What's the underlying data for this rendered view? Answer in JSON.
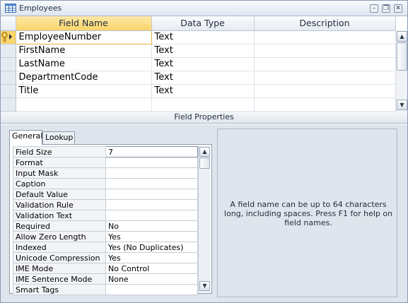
{
  "window": {
    "title": "Employees",
    "minimize": "–",
    "restore": "❐",
    "close": "✕"
  },
  "grid": {
    "columns": [
      "Field Name",
      "Data Type",
      "Description"
    ],
    "rows": [
      {
        "name": "EmployeeNumber",
        "type": "Text",
        "description": "",
        "primary_key": true
      },
      {
        "name": "FirstName",
        "type": "Text",
        "description": ""
      },
      {
        "name": "LastName",
        "type": "Text",
        "description": ""
      },
      {
        "name": "DepartmentCode",
        "type": "Text",
        "description": ""
      },
      {
        "name": "Title",
        "type": "Text",
        "description": ""
      },
      {
        "name": "",
        "type": "",
        "description": ""
      }
    ]
  },
  "field_properties": {
    "header": "Field Properties",
    "tabs": [
      "General",
      "Lookup"
    ],
    "properties": [
      {
        "name": "Field Size",
        "value": "7"
      },
      {
        "name": "Format",
        "value": ""
      },
      {
        "name": "Input Mask",
        "value": ""
      },
      {
        "name": "Caption",
        "value": ""
      },
      {
        "name": "Default Value",
        "value": ""
      },
      {
        "name": "Validation Rule",
        "value": ""
      },
      {
        "name": "Validation Text",
        "value": ""
      },
      {
        "name": "Required",
        "value": "No"
      },
      {
        "name": "Allow Zero Length",
        "value": "Yes"
      },
      {
        "name": "Indexed",
        "value": "Yes (No Duplicates)"
      },
      {
        "name": "Unicode Compression",
        "value": "Yes"
      },
      {
        "name": "IME Mode",
        "value": "No Control"
      },
      {
        "name": "IME Sentence Mode",
        "value": "None"
      },
      {
        "name": "Smart Tags",
        "value": ""
      }
    ],
    "help": "A field name can be up to 64 characters long, including spaces. Press F1 for help on field names."
  },
  "icons": {
    "title": "table-icon",
    "primary_key": "key-icon",
    "scroll_up": "▲",
    "scroll_down": "▼"
  }
}
